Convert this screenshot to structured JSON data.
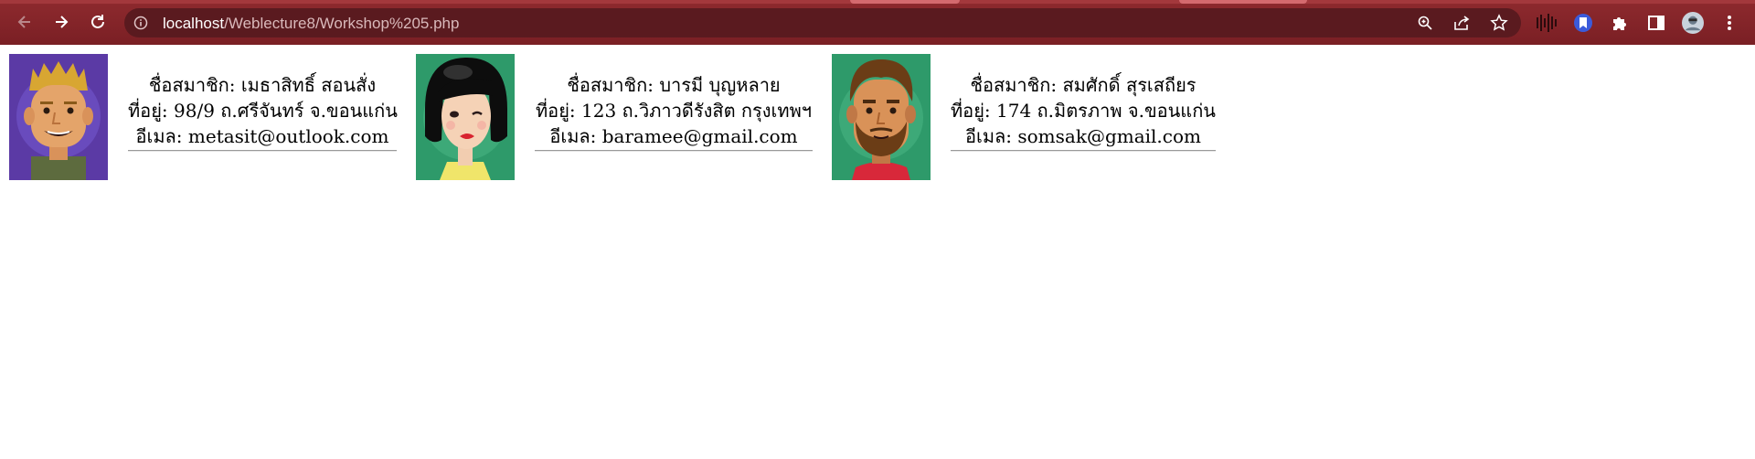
{
  "browser": {
    "url_host": "localhost",
    "url_path": "/Weblecture8/Workshop%205.php",
    "back_icon": "back-arrow-icon",
    "forward_icon": "forward-arrow-icon",
    "reload_icon": "reload-icon",
    "site_info_icon": "info-icon",
    "zoom_icon": "zoom-icon",
    "share_icon": "share-icon",
    "bookmark_icon": "star-icon",
    "extensions": [
      "soundwave-extension-icon",
      "bookmark-extension-icon",
      "puzzle-extensions-icon",
      "side-panel-icon",
      "profile-avatar-icon",
      "kebab-menu-icon"
    ],
    "theme_color": "#7a1f24"
  },
  "members": [
    {
      "name_label": "ชื่อสมาชิก: เมธาสิทธิ์ สอนสั่ง",
      "address_label": "ที่อยู่: 98/9 ถ.ศรีจันทร์ จ.ขอนแก่น",
      "email_label": "อีเมล: metasit@outlook.com",
      "avatar_bg": "#5b3aa5"
    },
    {
      "name_label": "ชื่อสมาชิก: บารมี บุญหลาย",
      "address_label": "ที่อยู่: 123 ถ.วิภาวดีรังสิต กรุงเทพฯ",
      "email_label": "อีเมล: baramee@gmail.com",
      "avatar_bg": "#2e9a6a"
    },
    {
      "name_label": "ชื่อสมาชิก: สมศักดิ์ สุรเสถียร",
      "address_label": "ที่อยู่: 174 ถ.มิตรภาพ จ.ขอนแก่น",
      "email_label": "อีเมล: somsak@gmail.com",
      "avatar_bg": "#2e9a6a"
    }
  ]
}
